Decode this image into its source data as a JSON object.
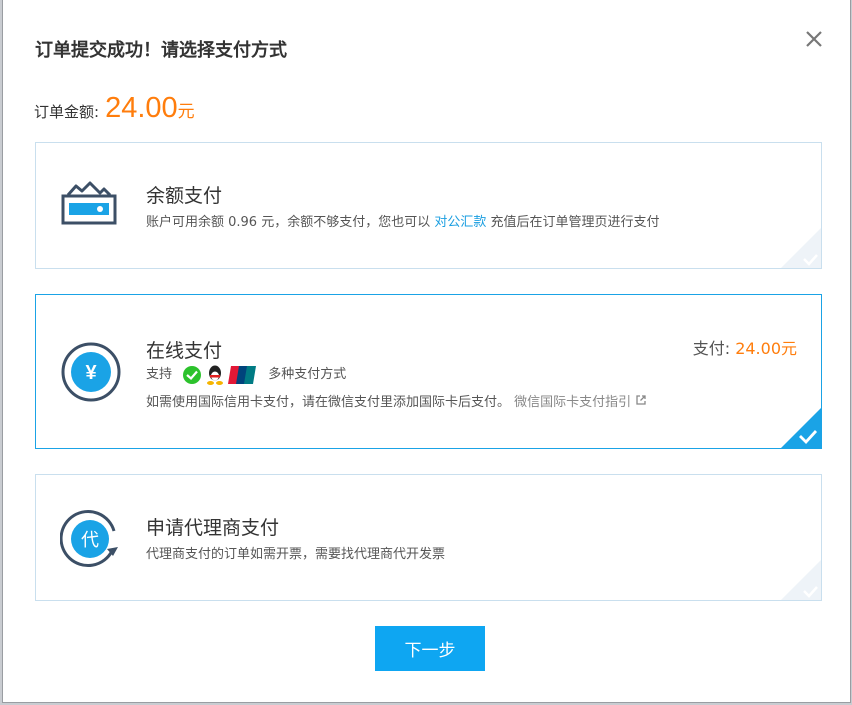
{
  "dialog": {
    "title": "订单提交成功！请选择支付方式",
    "amount_label": "订单金额:",
    "amount_value": "24.00",
    "amount_unit": "元"
  },
  "options": {
    "balance": {
      "title": "余额支付",
      "desc_pre": "账户可用余额 0.96 元，余额不够支付，您也可以",
      "link": "对公汇款",
      "desc_post": "充值后在订单管理页进行支付"
    },
    "online": {
      "title": "在线支付",
      "pay_label": "支付:",
      "pay_value": "24.00元",
      "support_label": "支持",
      "methods_label": "多种支付方式",
      "note": "如需使用国际信用卡支付，请在微信支付里添加国际卡后支付。",
      "guide_link": "微信国际卡支付指引",
      "selected": true
    },
    "agent": {
      "title": "申请代理商支付",
      "desc": "代理商支付的订单如需开票，需要找代理商代开发票",
      "icon_char": "代"
    }
  },
  "next_button": "下一步",
  "colors": {
    "accent": "#1aa3e6",
    "price": "#ff7d0c",
    "icon_dark": "#3c4f66"
  }
}
